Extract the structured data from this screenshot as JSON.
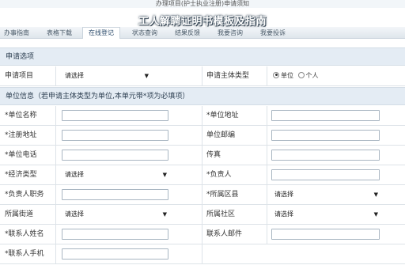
{
  "page": {
    "notice": "办理项目(护士执业注册)申请须知",
    "overlay_title": "工人解聘证明书模板及指南"
  },
  "tabs": [
    {
      "label": "办事指南"
    },
    {
      "label": "表格下载"
    },
    {
      "label": "在线登记"
    },
    {
      "label": "状态查询"
    },
    {
      "label": "结果反馈"
    },
    {
      "label": "我要咨询"
    },
    {
      "label": "我要投诉"
    }
  ],
  "sections": {
    "apply": "申请选项",
    "unit": "单位信息（若申请主体类型为单位,本单元带*项为必填项）"
  },
  "apply_row": {
    "item_label": "申请项目",
    "item_value": "请选择",
    "type_label": "申请主体类型",
    "radio_unit": "单位",
    "radio_person": "个人"
  },
  "fields": {
    "unit_name": "*单位名称",
    "unit_address": "*单位地址",
    "reg_address": "*注册地址",
    "unit_postcode": "单位邮编",
    "unit_phone": "*单位电话",
    "fax": "传真",
    "econ_type": "*经济类型",
    "econ_value": "请选择",
    "leader": "*负责人",
    "leader_title": "*负责人职务",
    "district": "*所属区县",
    "district_value": "请选择",
    "street": "所属街道",
    "street_value": "请选择",
    "community": "所属社区",
    "community_value": "请选择",
    "contact_name": "*联系人姓名",
    "contact_email": "联系人邮件",
    "contact_mobile": "*联系人手机"
  },
  "icons": {
    "dropdown_arrow": "▼"
  }
}
